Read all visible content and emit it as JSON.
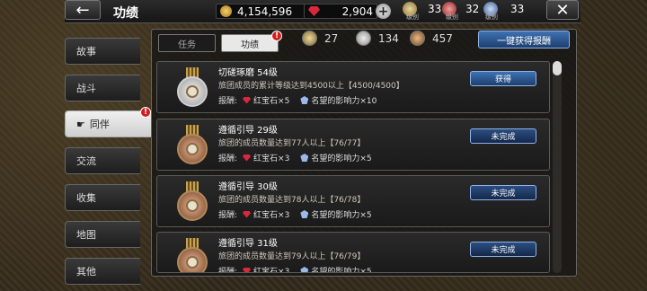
{
  "header": {
    "back_label": "←",
    "title": "功绩",
    "gold": "4,154,596",
    "rubies": "2,904",
    "plus_label": "+",
    "ranks": [
      {
        "label": "级别",
        "value": "33"
      },
      {
        "label": "级别",
        "value": "32"
      },
      {
        "label": "级别",
        "value": "33"
      }
    ],
    "close_label": "✕"
  },
  "sidebar": {
    "items": [
      {
        "label": "故事"
      },
      {
        "label": "战斗"
      },
      {
        "label": "同伴"
      },
      {
        "label": "交流"
      },
      {
        "label": "收集"
      },
      {
        "label": "地图"
      },
      {
        "label": "其他"
      }
    ],
    "active_index": 2
  },
  "tabs": [
    {
      "label": "任务"
    },
    {
      "label": "功绩"
    }
  ],
  "badge_text": "!",
  "summary": [
    {
      "value": "27"
    },
    {
      "value": "134"
    },
    {
      "value": "457"
    }
  ],
  "claim_all_label": "一键获得报酬",
  "rows": [
    {
      "title": "切磋琢磨  54级",
      "desc": "旅团成员的累计等级达到4500以上【4500/4500】",
      "reward_label": "报酬:",
      "gem_reward": "红宝石×5",
      "fame_reward": "名望的影响力×10",
      "button": "获得"
    },
    {
      "title": "遵循引导  29级",
      "desc": "旅团的成员数量达到77人以上【76/77】",
      "reward_label": "报酬:",
      "gem_reward": "红宝石×3",
      "fame_reward": "名望的影响力×5",
      "button": "未完成"
    },
    {
      "title": "遵循引导  30级",
      "desc": "旅团的成员数量达到78人以上【76/78】",
      "reward_label": "报酬:",
      "gem_reward": "红宝石×3",
      "fame_reward": "名望的影响力×5",
      "button": "未完成"
    },
    {
      "title": "遵循引导  31级",
      "desc": "旅团的成员数量达到79人以上【76/79】",
      "reward_label": "报酬:",
      "gem_reward": "红宝石×3",
      "fame_reward": "名望的影响力×5",
      "button": "未完成"
    }
  ],
  "colors": {
    "accent_blue": "#3f71b3",
    "ruby": "#d8283c",
    "badge_red": "#d21e1e"
  }
}
